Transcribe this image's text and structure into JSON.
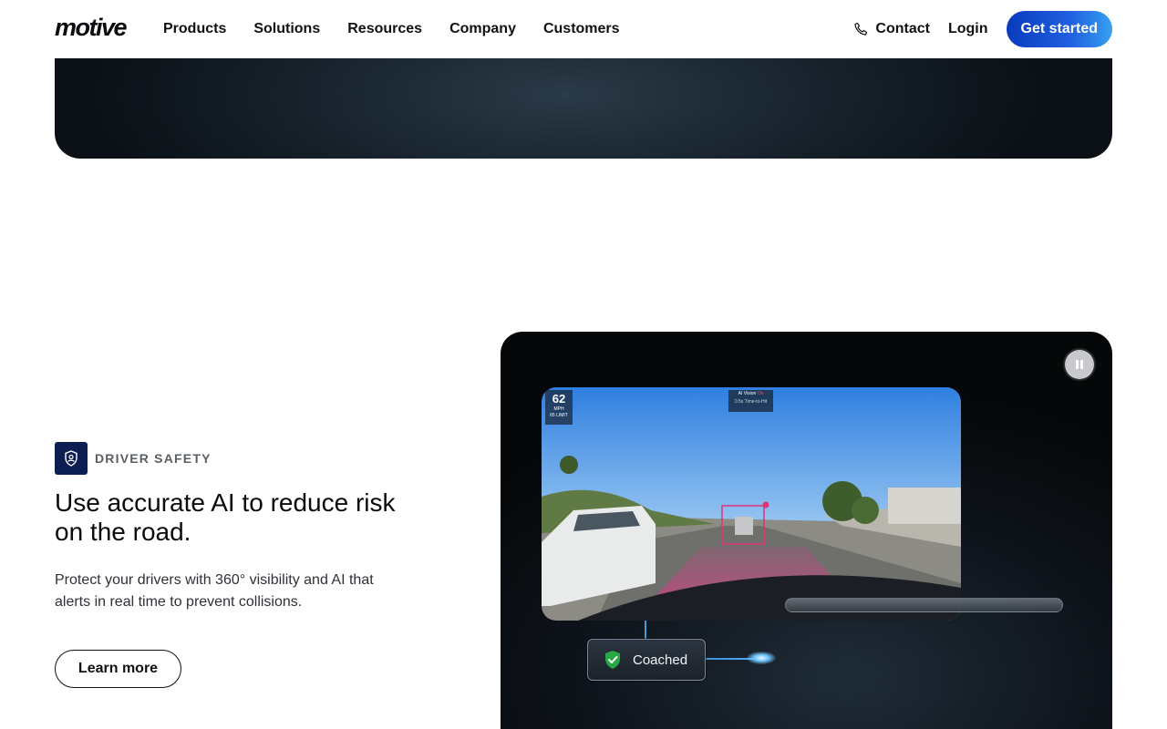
{
  "nav": {
    "logo": "motive",
    "links": [
      "Products",
      "Solutions",
      "Resources",
      "Company",
      "Customers"
    ],
    "contact": "Contact",
    "login": "Login",
    "cta": "Get started"
  },
  "feature": {
    "eyebrow": "DRIVER SAFETY",
    "eyebrow_icon": "shield-person-icon",
    "headline": "Use accurate AI to reduce risk on the road.",
    "description": "Protect your drivers with 360° visibility and AI that alerts in real time to prevent collisions.",
    "button": "Learn more"
  },
  "video": {
    "speed": "62",
    "speed_unit": "MPH",
    "speed_limit": "65 LIMIT",
    "aivision_label": "AI Vision",
    "aivision_state": "On",
    "aivision_sub": "0.5s Time-to-Hit",
    "coached_label": "Coached",
    "colors": {
      "accent": "#1f5fe0",
      "alert": "#e0327a",
      "ok": "#27a844"
    }
  }
}
